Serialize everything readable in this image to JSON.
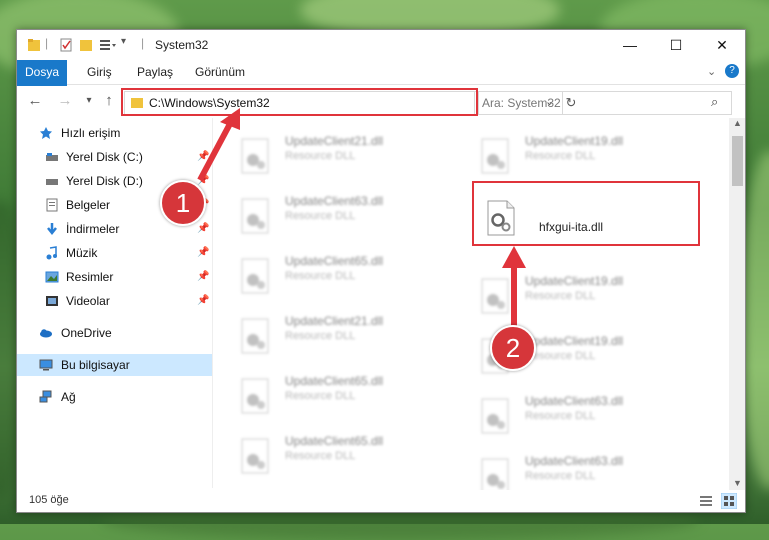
{
  "window": {
    "title": "System32",
    "controls": {
      "minimize": "—",
      "maximize": "☐",
      "close": "✕"
    }
  },
  "ribbon": {
    "tabs": [
      "Dosya",
      "Giriş",
      "Paylaş",
      "Görünüm"
    ]
  },
  "navigation": {
    "address_path": "C:\\Windows\\System32",
    "search_placeholder": "Ara: System32"
  },
  "sidebar": {
    "items": [
      {
        "label": "Hızlı erişim",
        "icon": "star-icon",
        "pinned": false
      },
      {
        "label": "Yerel Disk (C:)",
        "icon": "drive-icon",
        "pinned": true
      },
      {
        "label": "Yerel Disk (D:)",
        "icon": "drive-icon",
        "pinned": true
      },
      {
        "label": "Belgeler",
        "icon": "documents-icon",
        "pinned": true
      },
      {
        "label": "İndirmeler",
        "icon": "download-icon",
        "pinned": true
      },
      {
        "label": "Müzik",
        "icon": "music-icon",
        "pinned": true
      },
      {
        "label": "Resimler",
        "icon": "pictures-icon",
        "pinned": true
      },
      {
        "label": "Videolar",
        "icon": "video-icon",
        "pinned": true
      },
      {
        "label": "OneDrive",
        "icon": "cloud-icon",
        "pinned": false
      },
      {
        "label": "Bu bilgisayar",
        "icon": "computer-icon",
        "pinned": false,
        "selected": true
      },
      {
        "label": "Ağ",
        "icon": "network-icon",
        "pinned": false
      }
    ]
  },
  "files": {
    "left_column": [
      {
        "name": "UpdateClient21.dll",
        "type": "Resource DLL"
      },
      {
        "name": "UpdateClient63.dll",
        "type": "Resource DLL"
      },
      {
        "name": "UpdateClient65.dll",
        "type": "Resource DLL"
      },
      {
        "name": "UpdateClient21.dll",
        "type": "Resource DLL"
      },
      {
        "name": "UpdateClient65.dll",
        "type": "Resource DLL"
      },
      {
        "name": "UpdateClient65.dll",
        "type": "Resource DLL"
      }
    ],
    "right_column": [
      {
        "name": "UpdateClient19.dll",
        "type": "Resource DLL"
      },
      {
        "name": "hfxgui-ita.dll",
        "type": "",
        "highlighted": true
      },
      {
        "name": "UpdateClient19.dll",
        "type": "Resource DLL"
      },
      {
        "name": "UpdateClient19.dll",
        "type": "Resource DLL"
      },
      {
        "name": "UpdateClient63.dll",
        "type": "Resource DLL"
      },
      {
        "name": "UpdateClient63.dll",
        "type": "Resource DLL"
      }
    ]
  },
  "annotations": {
    "badge1": "1",
    "badge2": "2"
  },
  "status": {
    "item_count": "105 öğe"
  },
  "colors": {
    "accent": "#1979ca",
    "annotation_red": "#e0343b",
    "selection": "#cce8ff"
  }
}
